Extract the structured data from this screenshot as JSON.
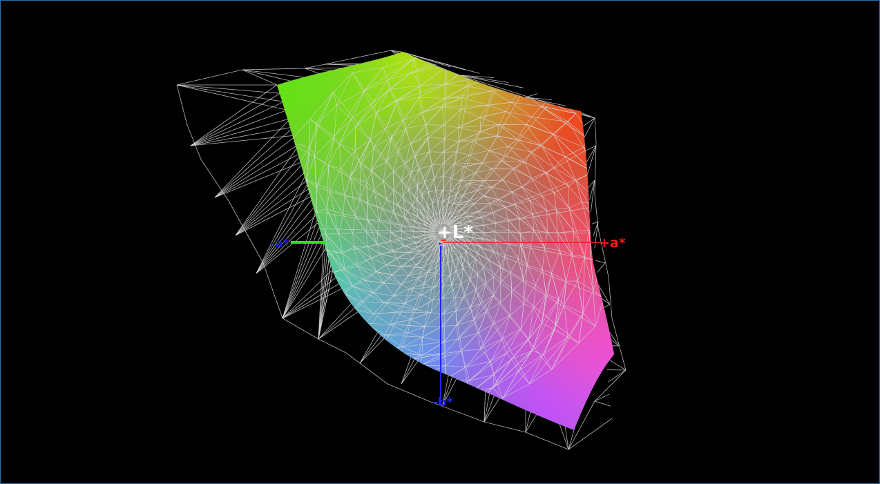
{
  "axes": {
    "l_label": "+L*",
    "a_pos_label": "+a*",
    "a_neg_label": "-a*",
    "b_neg_label": "-b*",
    "l_color": "#ffffff",
    "a_pos_color": "#ff1a1a",
    "a_neg_color": "#1a1acc",
    "b_neg_color": "#2222ff",
    "a_neg_bar_color": "#33dd22"
  },
  "colors": {
    "background": "#000000",
    "wireframe": "#d8d8d8",
    "border": "#2f6fb0",
    "gamut_corners": {
      "top_left": "#63e313",
      "top": "#e3e013",
      "top_right": "#f25a1a",
      "center": "#8a8a82",
      "right": "#ee5a9a",
      "bottom_right": "#f060f0",
      "bottom": "#9a5aff",
      "bottom_left": "#5aa8e8",
      "left": "#4ee0a0"
    }
  }
}
